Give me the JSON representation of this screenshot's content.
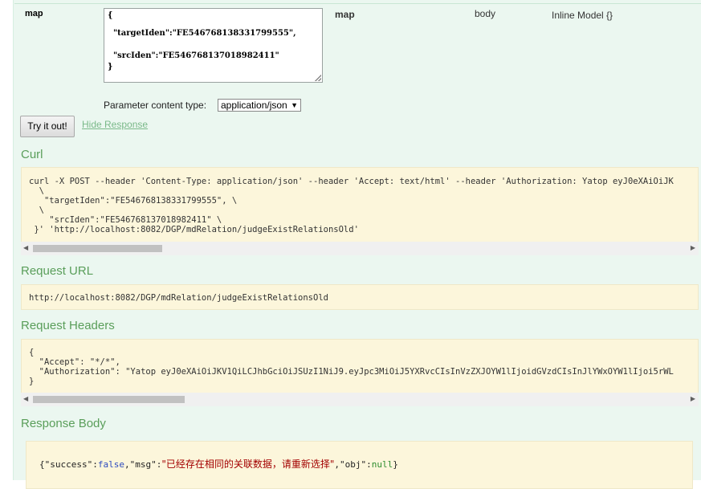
{
  "parameter": {
    "name": "map",
    "value_lines": [
      "{",
      "  \"targetIden\":\"FE546768138331799555\",",
      "  \"srcIden\":\"FE546768137018982411\"",
      "}"
    ],
    "description": "map",
    "param_type": "body",
    "data_type": "Inline Model {}"
  },
  "content_type": {
    "label": "Parameter content type:",
    "selected": "application/json"
  },
  "actions": {
    "try_label": "Try it out!",
    "hide_label": "Hide Response"
  },
  "curl": {
    "title": "Curl",
    "text": "curl -X POST --header 'Content-Type: application/json' --header 'Accept: text/html' --header 'Authorization: Yatop eyJ0eXAiOiJK\n  \\\n   \"targetIden\":\"FE546768138331799555\", \\\n  \\\n    \"srcIden\":\"FE546768137018982411\" \\\n }' 'http://localhost:8082/DGP/mdRelation/judgeExistRelationsOld'"
  },
  "request_url": {
    "title": "Request URL",
    "text": "http://localhost:8082/DGP/mdRelation/judgeExistRelationsOld"
  },
  "request_headers": {
    "title": "Request Headers",
    "text": "{\n  \"Accept\": \"*/*\",\n  \"Authorization\": \"Yatop eyJ0eXAiOiJKV1QiLCJhbGciOiJSUzI1NiJ9.eyJpc3MiOiJ5YXRvcCIsInVzZXJOYW1lIjoidGVzdCIsInJlYWxOYW1lIjoi5rWL\n}"
  },
  "response_body": {
    "title": "Response Body",
    "key_success": "\"success\"",
    "val_success": "false",
    "key_msg": "\"msg\"",
    "val_msg": "\"已经存在相同的关联数据，请重新选择\"",
    "key_obj": "\"obj\"",
    "val_obj": "null",
    "open": "{",
    "close": "}",
    "colon": ":",
    "comma": ","
  },
  "scroll": {
    "arrow_left": "◀",
    "arrow_right": "▶",
    "select_arrow": "▼"
  }
}
